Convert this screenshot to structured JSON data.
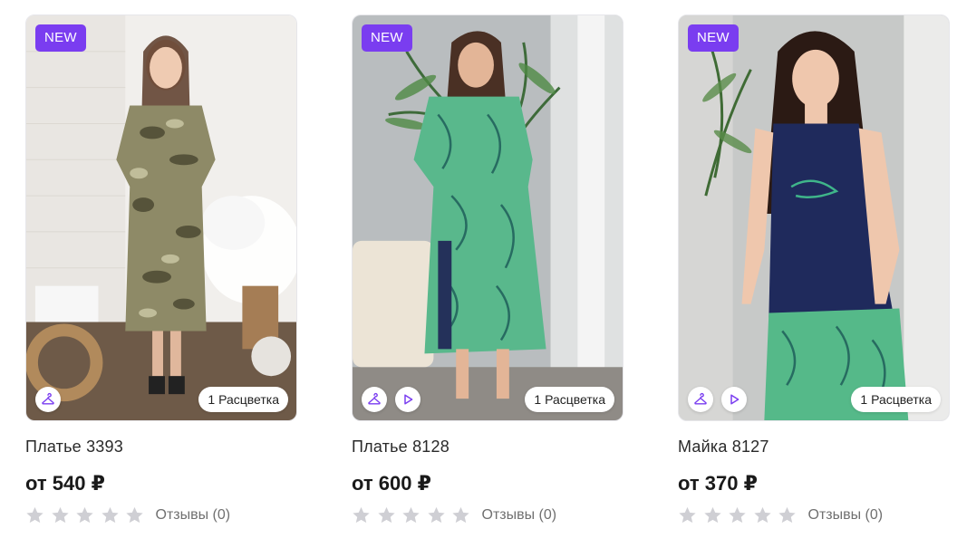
{
  "colors": {
    "badge_bg": "#7a3df0",
    "icon_accent": "#7a3df0",
    "star_empty": "#cfcfd4"
  },
  "products": [
    {
      "badge": "NEW",
      "name": "Платье 3393",
      "price": "от 540 ₽",
      "colors_label": "1 Расцветка",
      "reviews_label": "Отзывы (0)",
      "has_video": false,
      "stars_filled": 0
    },
    {
      "badge": "NEW",
      "name": "Платье 8128",
      "price": "от 600 ₽",
      "colors_label": "1 Расцветка",
      "reviews_label": "Отзывы (0)",
      "has_video": true,
      "stars_filled": 0
    },
    {
      "badge": "NEW",
      "name": "Майка 8127",
      "price": "от 370 ₽",
      "colors_label": "1 Расцветка",
      "reviews_label": "Отзывы (0)",
      "has_video": true,
      "stars_filled": 0
    }
  ]
}
